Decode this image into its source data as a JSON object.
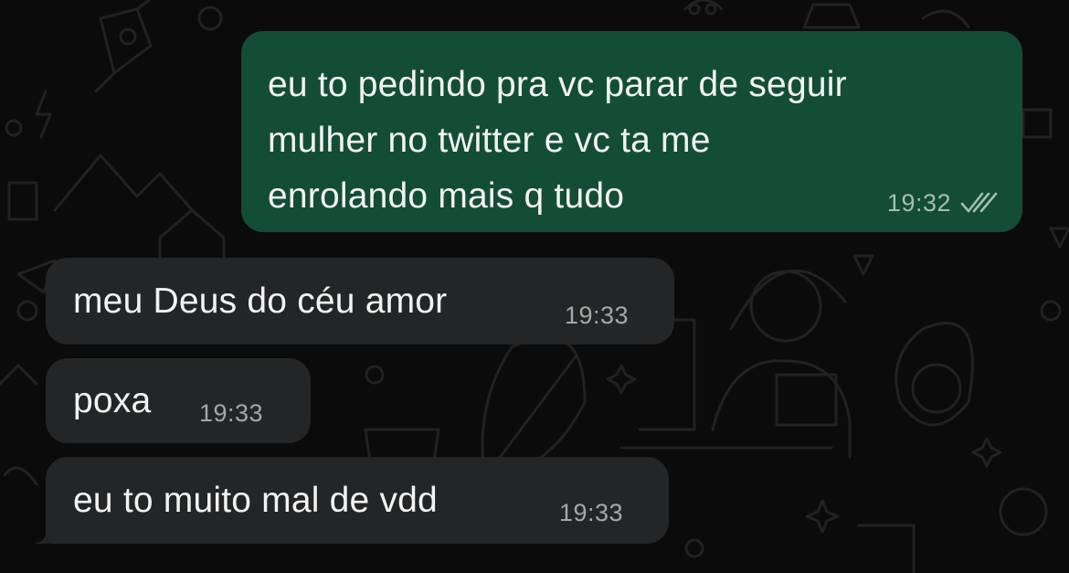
{
  "messages": [
    {
      "direction": "outgoing",
      "text": "eu to pedindo pra vc parar de seguir\nmulher no twitter e vc ta me\nenrolando mais q tudo",
      "time": "19:32",
      "status_icon": "double-check-icon"
    },
    {
      "direction": "incoming",
      "text": "meu Deus do céu amor",
      "time": "19:33"
    },
    {
      "direction": "incoming",
      "text": "poxa",
      "time": "19:33"
    },
    {
      "direction": "incoming",
      "text": "eu to muito mal de vdd",
      "time": "19:33"
    }
  ],
  "colors": {
    "background": "#0b0b0b",
    "outgoing_bubble": "#144d37",
    "incoming_bubble": "#242526",
    "text": "#f2f2f2",
    "timestamp": "#a7a7a7",
    "wallpaper_doodle": "#1f1f1f"
  }
}
